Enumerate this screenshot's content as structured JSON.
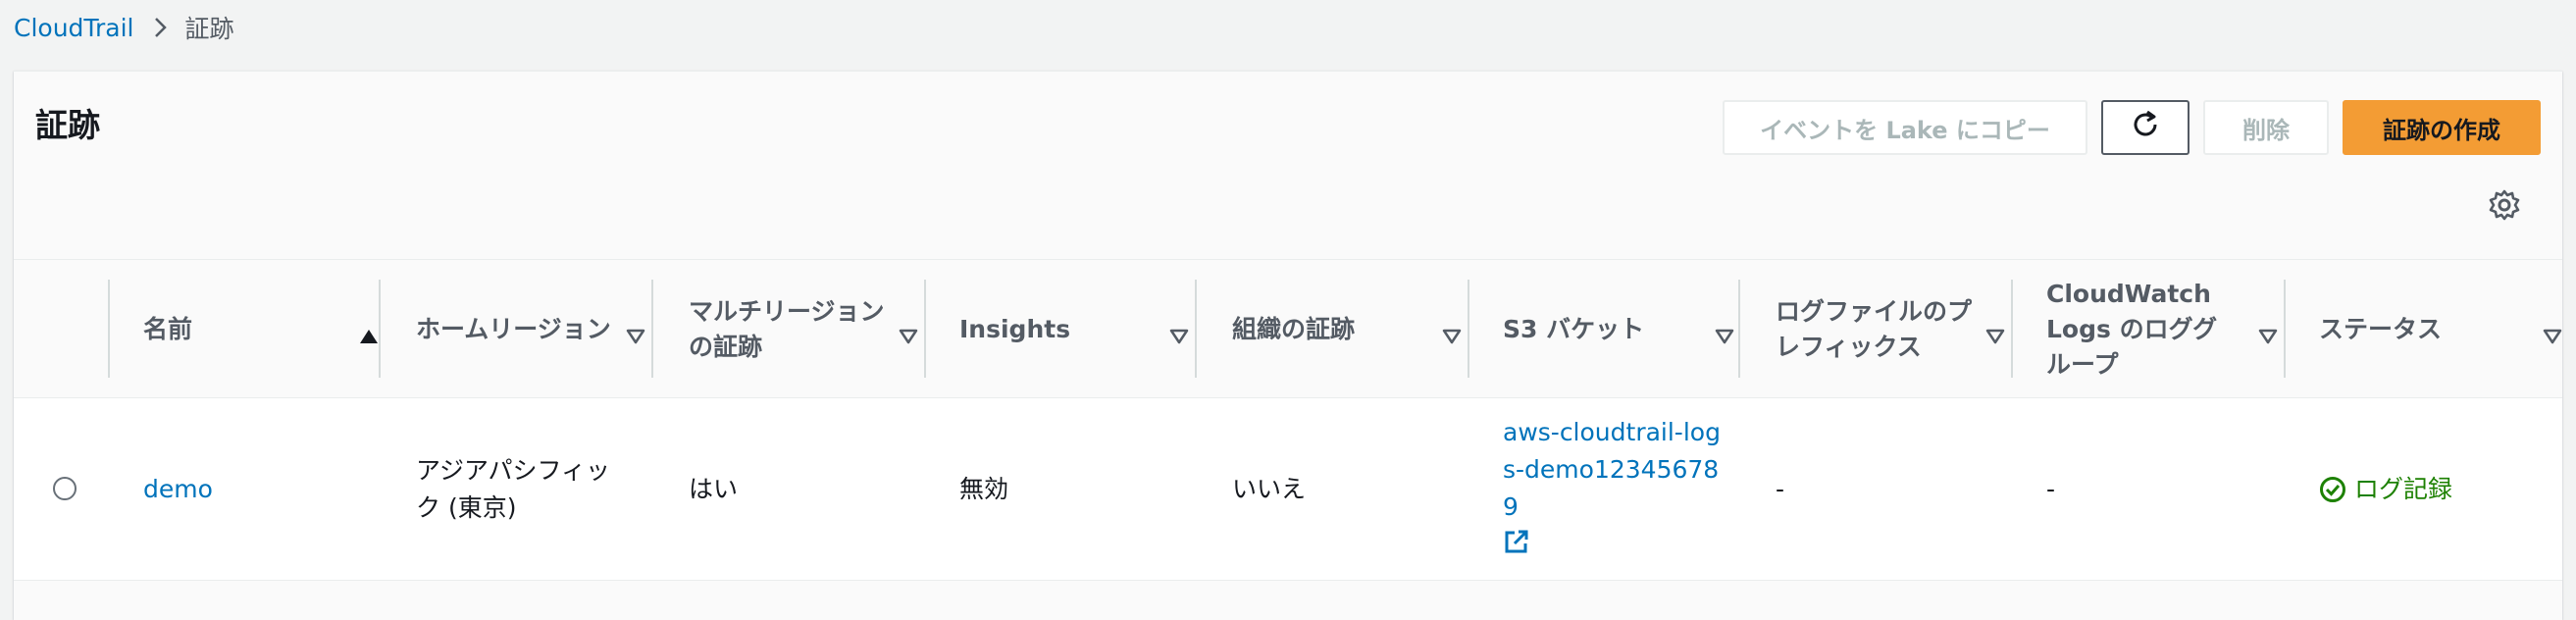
{
  "breadcrumb": {
    "root": "CloudTrail",
    "current": "証跡"
  },
  "page": {
    "title": "証跡"
  },
  "actions": {
    "copy_to_lake": "イベントを Lake にコピー",
    "delete": "削除",
    "create": "証跡の作成"
  },
  "colors": {
    "accent": "#f39c34",
    "link": "#0073bb",
    "success": "#1d8102"
  },
  "table": {
    "columns": [
      {
        "label": "名前"
      },
      {
        "label": "ホームリージョン"
      },
      {
        "label": "マルチリージョンの証跡"
      },
      {
        "label": "Insights"
      },
      {
        "label": "組織の証跡"
      },
      {
        "label": "S3 バケット"
      },
      {
        "label": "ログファイルのプレフィックス"
      },
      {
        "label": "CloudWatch Logs のロググループ"
      },
      {
        "label": "ステータス"
      }
    ],
    "rows": [
      {
        "name": "demo",
        "home_region": "アジアパシフィック (東京)",
        "multi_region": "はい",
        "insights": "無効",
        "organization_trail": "いいえ",
        "s3_bucket": "aws-cloudtrail-logs-demo123456789",
        "log_prefix": "-",
        "cloudwatch_log_group": "-",
        "status": "ログ記録"
      }
    ]
  }
}
